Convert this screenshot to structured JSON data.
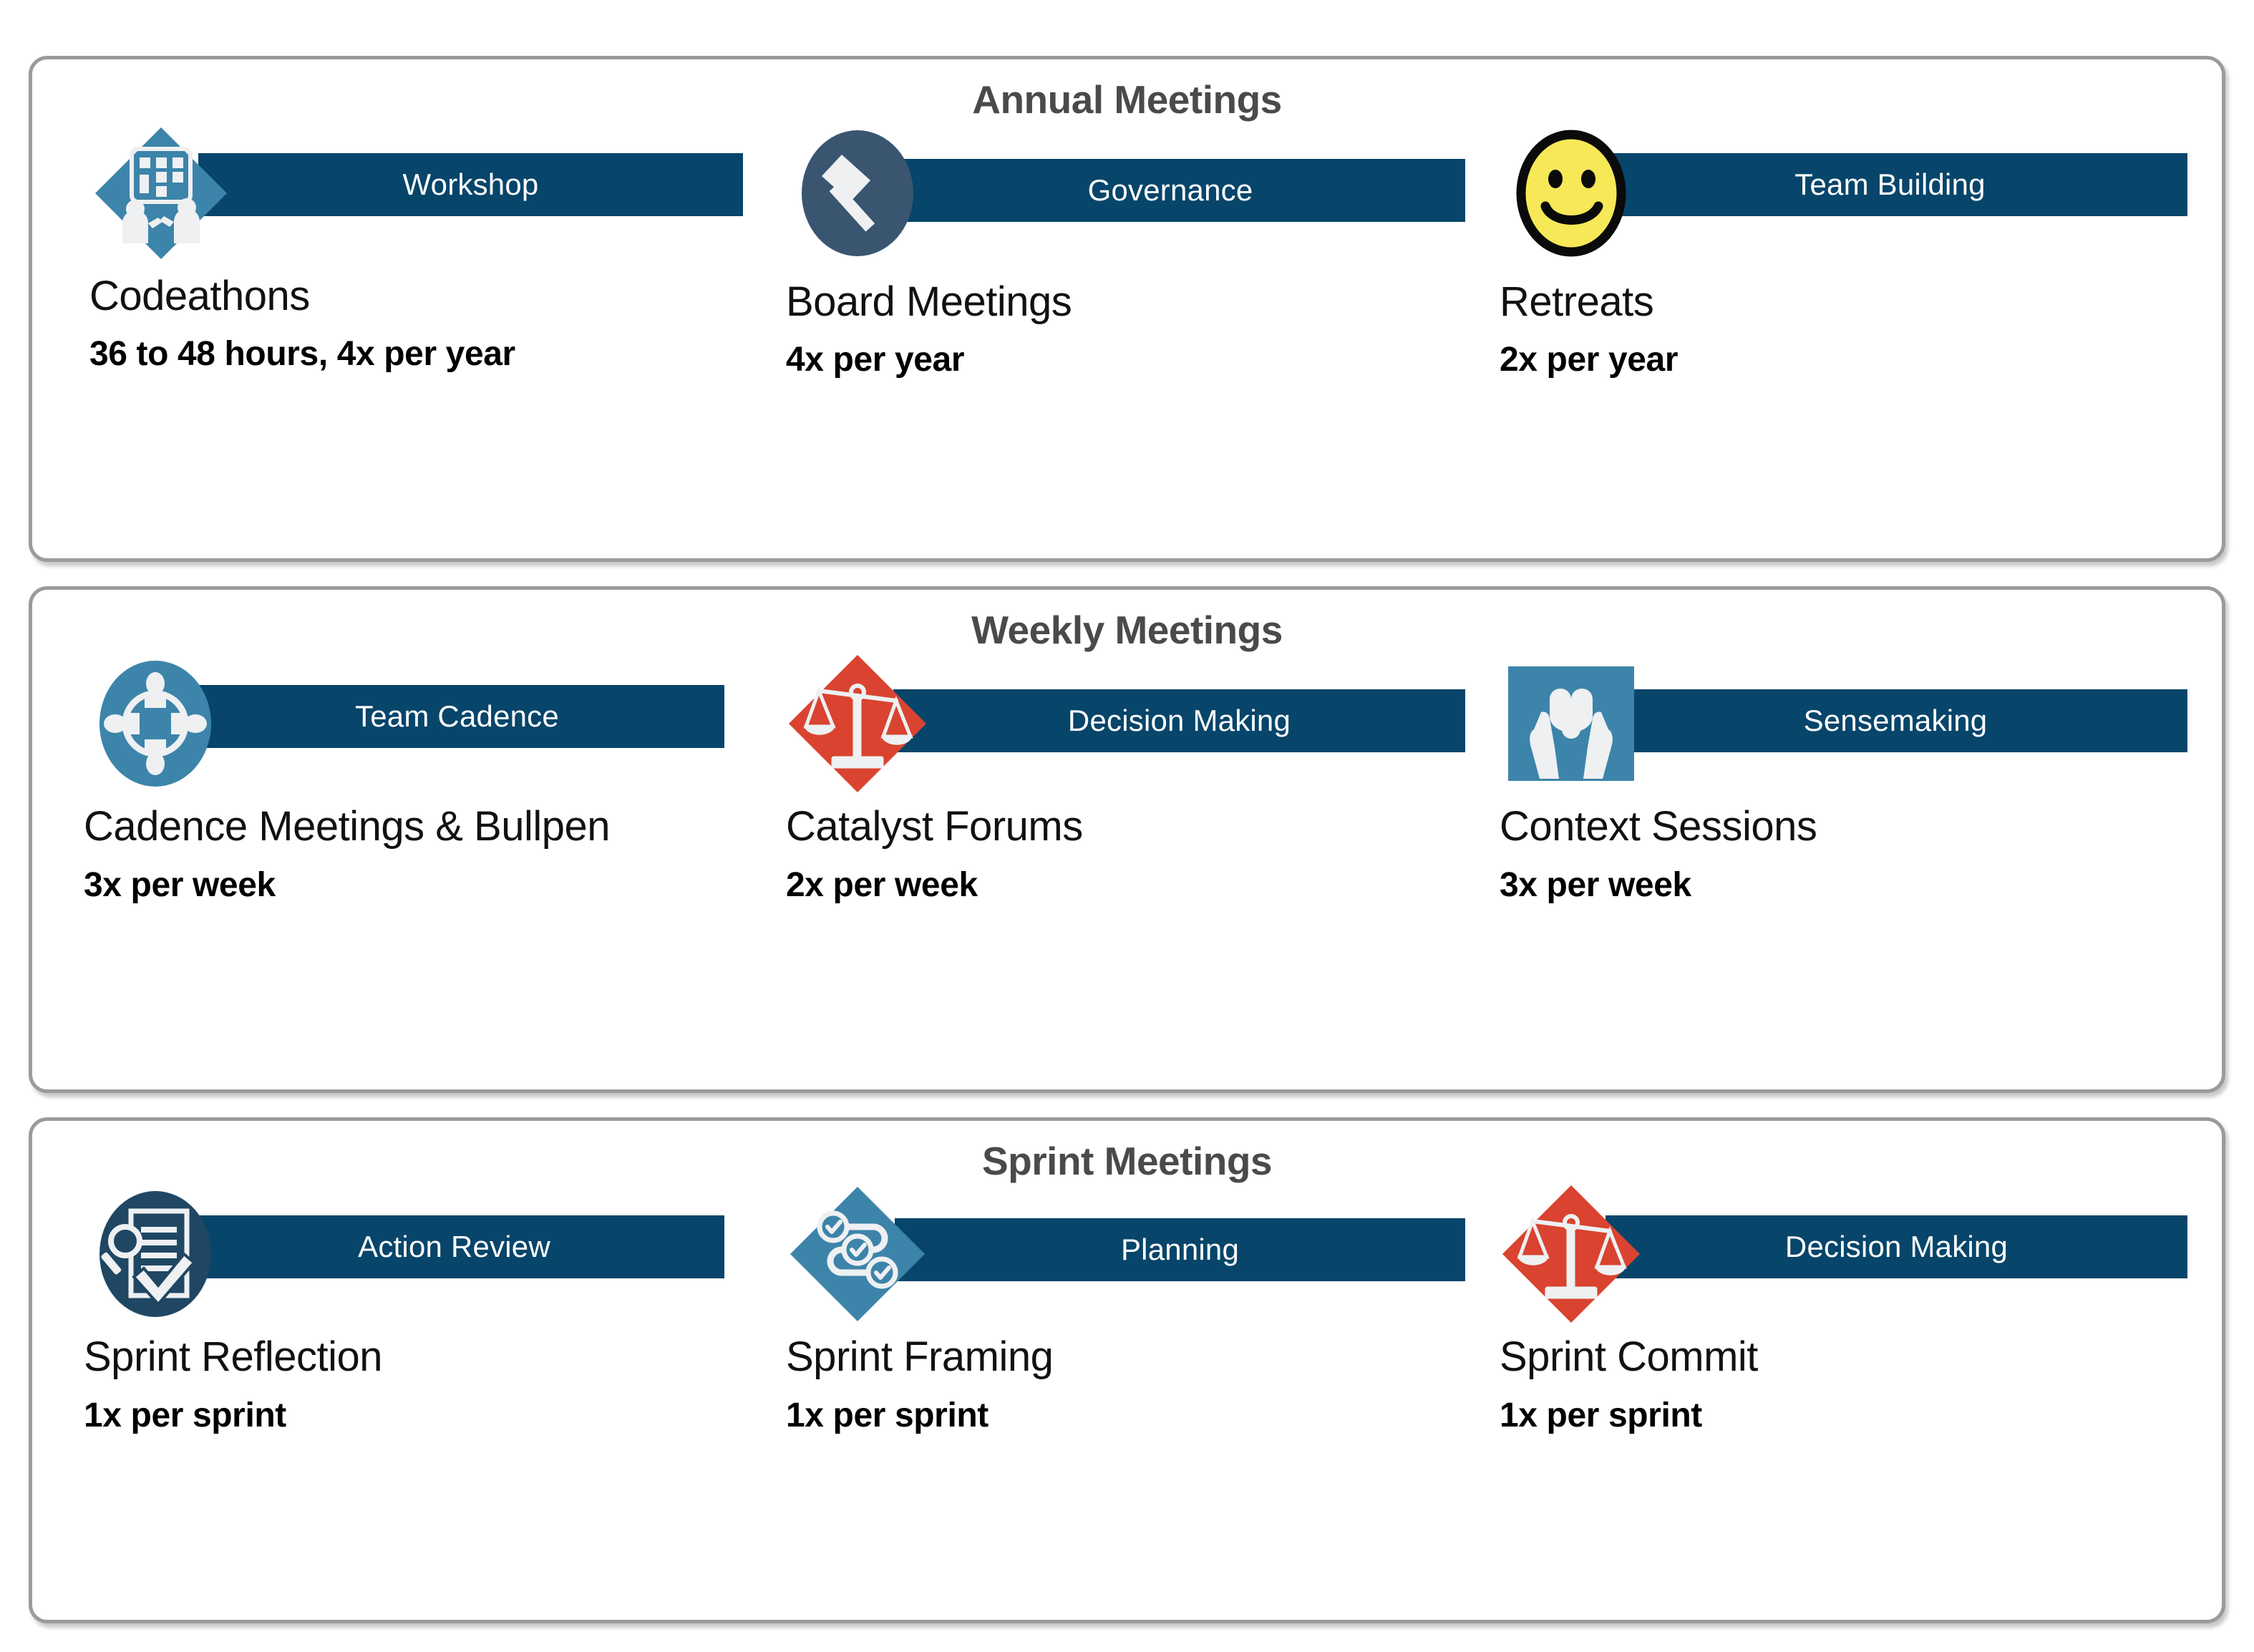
{
  "colors": {
    "banner": "#07456a",
    "card_border": "#9b9b9b",
    "section_title": "#4a4a4a",
    "icon_blue_medium": "#3d84aa",
    "icon_navy_circle": "#3a5570",
    "icon_navy_dark": "#1f4763",
    "icon_red": "#d9432f",
    "icon_yellow": "#f7e857",
    "icon_glyph": "#eef0f2"
  },
  "sections": [
    {
      "title": "Annual Meetings",
      "items": [
        {
          "banner_label": "Workshop",
          "name": "Codeathons",
          "cadence": "36 to 48 hours, 4x per year",
          "icon": "workshop-people-board-icon",
          "icon_shape": "diamond",
          "icon_color": "#3d84aa"
        },
        {
          "banner_label": "Governance",
          "name": "Board Meetings",
          "cadence": "4x per year",
          "icon": "gavel-icon",
          "icon_shape": "circle",
          "icon_color": "#3a5570"
        },
        {
          "banner_label": "Team Building",
          "name": "Retreats",
          "cadence": "2x per year",
          "icon": "smiley-face-icon",
          "icon_shape": "circle",
          "icon_color": "#f7e857"
        }
      ]
    },
    {
      "title": "Weekly Meetings",
      "items": [
        {
          "banner_label": "Team Cadence",
          "name": "Cadence Meetings & Bullpen",
          "cadence": "3x per week",
          "icon": "people-ring-icon",
          "icon_shape": "circle",
          "icon_color": "#3d84aa"
        },
        {
          "banner_label": "Decision Making",
          "name": "Catalyst Forums",
          "cadence": "2x per week",
          "icon": "balance-scale-icon",
          "icon_shape": "diamond",
          "icon_color": "#d9432f"
        },
        {
          "banner_label": "Sensemaking",
          "name": "Context Sessions",
          "cadence": "3x per week",
          "icon": "hands-holding-puzzle-icon",
          "icon_shape": "square",
          "icon_color": "#3d84aa"
        }
      ]
    },
    {
      "title": "Sprint Meetings",
      "items": [
        {
          "banner_label": "Action Review",
          "name": "Sprint Reflection",
          "cadence": "1x per sprint",
          "icon": "document-magnifier-check-icon",
          "icon_shape": "circle",
          "icon_color": "#1f4763"
        },
        {
          "banner_label": "Planning",
          "name": "Sprint Framing",
          "cadence": "1x per sprint",
          "icon": "workflow-checklist-icon",
          "icon_shape": "diamond",
          "icon_color": "#3d84aa"
        },
        {
          "banner_label": "Decision Making",
          "name": "Sprint Commit",
          "cadence": "1x per sprint",
          "icon": "balance-scale-icon",
          "icon_shape": "diamond",
          "icon_color": "#d9432f"
        }
      ]
    }
  ]
}
